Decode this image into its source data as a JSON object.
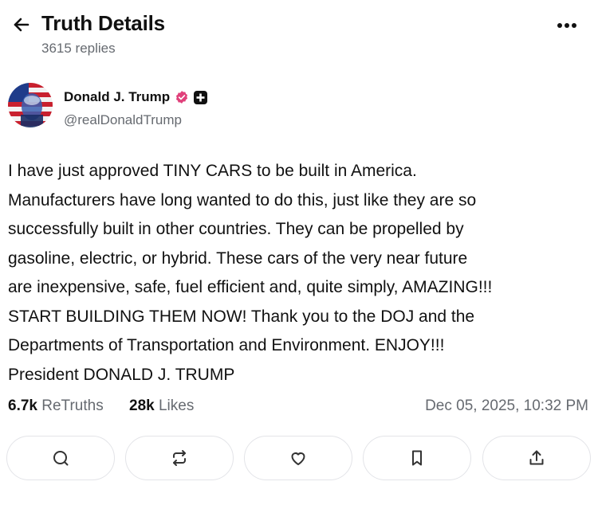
{
  "header": {
    "title": "Truth Details",
    "replies": "3615 replies",
    "back_icon": "arrow-left-icon",
    "more_icon": "more-horizontal-icon"
  },
  "author": {
    "name": "Donald J. Trump",
    "handle": "@realDonaldTrump",
    "verified_icon": "verified-badge-icon",
    "plus_icon": "plus-badge-icon"
  },
  "post": {
    "lines": [
      "I have just approved TINY CARS to be built in America.",
      "Manufacturers have long wanted to do this, just like they are so",
      "successfully built in other countries. They can be propelled by",
      "gasoline, electric, or hybrid. These cars of the very near future",
      "are inexpensive, safe, fuel efficient and, quite simply, AMAZING!!!",
      "START BUILDING THEM NOW! Thank you to the DOJ and the",
      "Departments of Transportation and Environment. ENJOY!!!",
      "President DONALD J. TRUMP"
    ]
  },
  "stats": {
    "retruths_count": "6.7k",
    "retruths_label": "ReTruths",
    "likes_count": "28k",
    "likes_label": "Likes",
    "timestamp": "Dec 05, 2025, 10:32 PM"
  },
  "actions": [
    {
      "icon": "reply-icon"
    },
    {
      "icon": "retruth-icon"
    },
    {
      "icon": "like-icon"
    },
    {
      "icon": "bookmark-icon"
    },
    {
      "icon": "share-icon"
    }
  ],
  "colors": {
    "text": "#111111",
    "muted": "#666a70",
    "verified": "#e0407a",
    "border": "#e3e4e8"
  }
}
